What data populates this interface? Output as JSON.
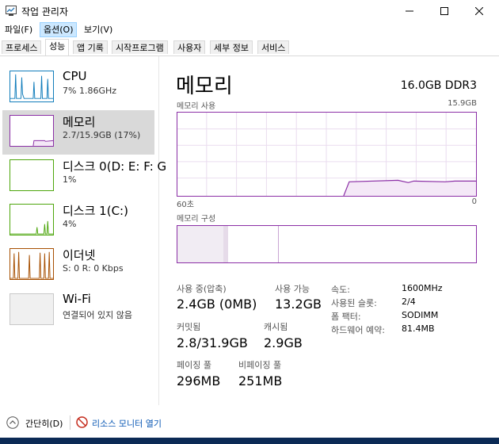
{
  "window": {
    "title": "작업 관리자"
  },
  "menu": [
    {
      "label": "파일(F)"
    },
    {
      "label": "옵션(O)"
    },
    {
      "label": "보기(V)"
    }
  ],
  "tabs": [
    {
      "label": "프로세스"
    },
    {
      "label": "성능"
    },
    {
      "label": "앱 기록"
    },
    {
      "label": "시작프로그램"
    },
    {
      "label": "사용자"
    },
    {
      "label": "세부 정보"
    },
    {
      "label": "서비스"
    }
  ],
  "sidebar": [
    {
      "title": "CPU",
      "sub": "7% 1.86GHz",
      "color": "#117dbb"
    },
    {
      "title": "메모리",
      "sub": "2.7/15.9GB (17%)",
      "color": "#8b2fa6"
    },
    {
      "title": "디스크 0(D: E: F: G",
      "sub": "1%",
      "color": "#4da60c"
    },
    {
      "title": "디스크 1(C:)",
      "sub": "4%",
      "color": "#4da60c"
    },
    {
      "title": "이더넷",
      "sub": "S: 0 R: 0 Kbps",
      "color": "#a74f01"
    },
    {
      "title": "Wi-Fi",
      "sub": "연결되어 있지 않음",
      "color": "#999999"
    }
  ],
  "main": {
    "title": "메모리",
    "spec": "16.0GB DDR3",
    "usage_label": "메모리 사용",
    "usage_max": "15.9GB",
    "time_label": "60초",
    "time_end": "0",
    "composition_label": "메모리 구성",
    "usage_fraction": 0.17
  },
  "stats": {
    "in_use_label": "사용 중(압축)",
    "in_use_value": "2.4GB (0MB)",
    "available_label": "사용 가능",
    "available_value": "13.2GB",
    "committed_label": "커밋됨",
    "committed_value": "2.8/31.9GB",
    "cached_label": "캐시됨",
    "cached_value": "2.9GB",
    "paged_label": "페이징 풀",
    "paged_value": "296MB",
    "nonpaged_label": "비페이징 풀",
    "nonpaged_value": "251MB"
  },
  "props": [
    {
      "label": "속도:",
      "value": "1600MHz"
    },
    {
      "label": "사용된 슬롯:",
      "value": "2/4"
    },
    {
      "label": "폼 팩터:",
      "value": "SODIMM"
    },
    {
      "label": "하드웨어 예약:",
      "value": "81.4MB"
    }
  ],
  "footer": {
    "fewer_details": "간단히(D)",
    "resource_monitor": "리소스 모니터 열기"
  }
}
